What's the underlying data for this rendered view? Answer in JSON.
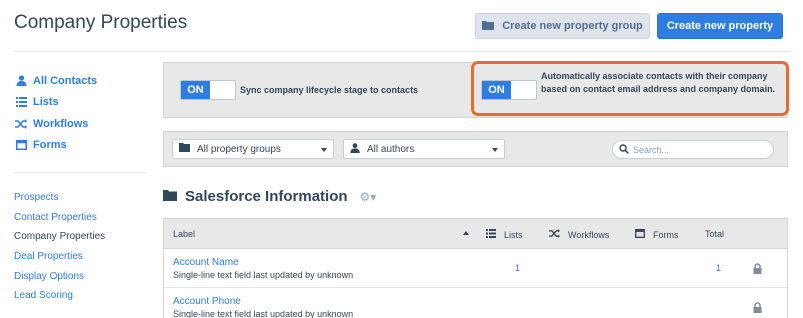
{
  "header": {
    "title": "Company Properties",
    "create_group_label": "Create new property group",
    "create_property_label": "Create new property"
  },
  "sidebar": {
    "primary": [
      {
        "label": "All Contacts",
        "icon": "user-icon"
      },
      {
        "label": "Lists",
        "icon": "list-icon"
      },
      {
        "label": "Workflows",
        "icon": "shuffle-icon"
      },
      {
        "label": "Forms",
        "icon": "form-icon"
      }
    ],
    "secondary": [
      {
        "label": "Prospects"
      },
      {
        "label": "Contact Properties"
      },
      {
        "label": "Company Properties",
        "active": true
      },
      {
        "label": "Deal Properties"
      },
      {
        "label": "Display Options"
      },
      {
        "label": "Lead Scoring"
      }
    ]
  },
  "toggles": [
    {
      "state": "ON",
      "text": "Sync company lifecycle stage to contacts"
    },
    {
      "state": "ON",
      "text": "Automatically associate contacts with their company based on contact email address and company domain."
    }
  ],
  "filters": {
    "groups_value": "All property groups",
    "authors_value": "All authors",
    "search_placeholder": "Search..."
  },
  "section": {
    "title": "Salesforce Information"
  },
  "table": {
    "columns": {
      "label": "Label",
      "lists": "Lists",
      "workflows": "Workflows",
      "forms": "Forms",
      "total": "Total"
    },
    "rows": [
      {
        "name": "Account Name",
        "desc_prefix": "Single-line text field last updated by ",
        "desc_user": "unknown",
        "lists": "1",
        "total": "1"
      },
      {
        "name": "Account Phone",
        "desc_prefix": "Single-line text field last updated by ",
        "desc_user": "unknown",
        "lists": "",
        "total": ""
      }
    ]
  },
  "colors": {
    "accent": "#2e7de0",
    "highlight": "#e86c2c"
  }
}
